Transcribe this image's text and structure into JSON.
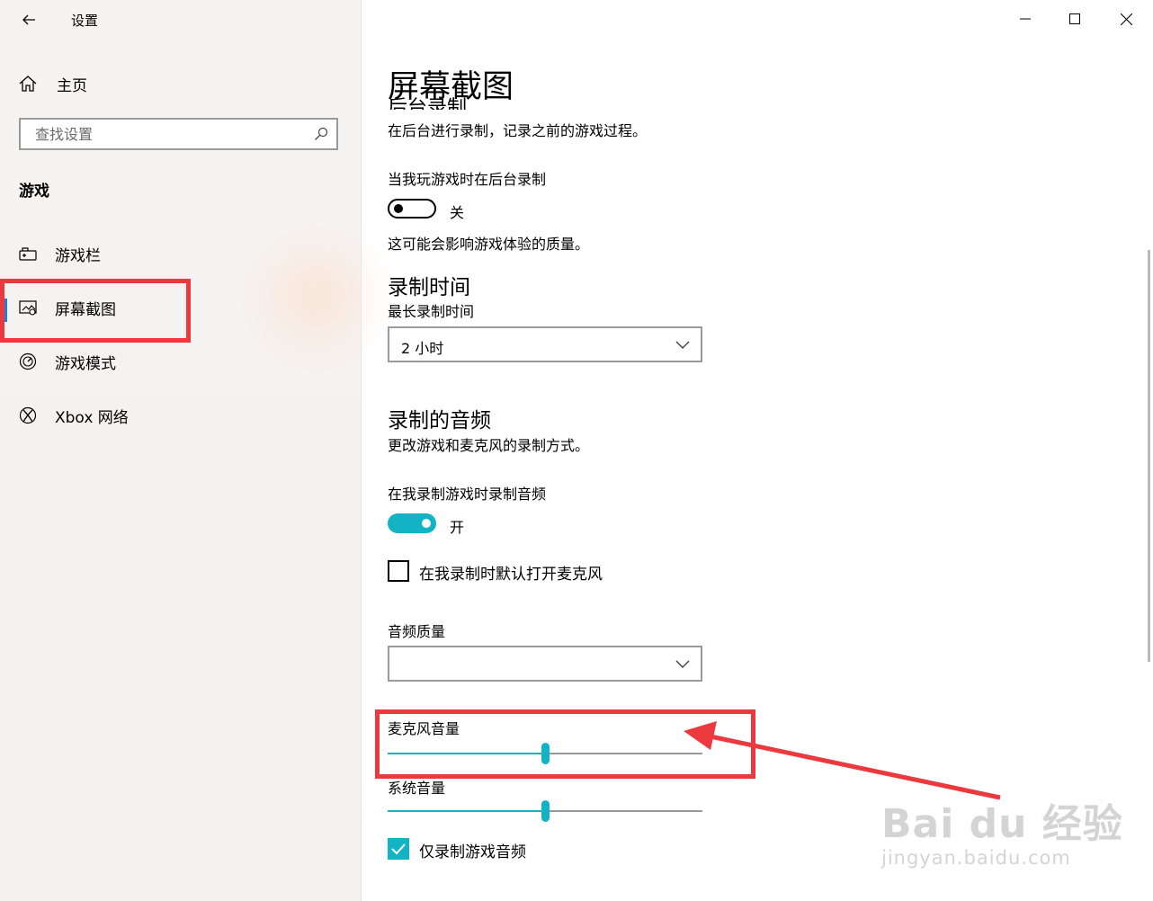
{
  "window": {
    "title": "设置",
    "controls": [
      "minimize-icon",
      "maximize-icon",
      "close-icon"
    ]
  },
  "sidebar": {
    "home_label": "主页",
    "search_placeholder": "查找设置",
    "section_label": "游戏",
    "items": [
      {
        "label": "游戏栏",
        "icon": "game-bar-icon",
        "active": false
      },
      {
        "label": "屏幕截图",
        "icon": "captures-icon",
        "active": true
      },
      {
        "label": "游戏模式",
        "icon": "game-mode-icon",
        "active": false
      },
      {
        "label": "Xbox 网络",
        "icon": "xbox-icon",
        "active": false
      }
    ]
  },
  "main": {
    "page_title": "屏幕截图",
    "background_recording": {
      "heading_partial": "后台录制",
      "description": "在后台进行录制，记录之前的游戏过程。",
      "toggle_title": "当我玩游戏时在后台录制",
      "toggle_state": "关",
      "note": "这可能会影响游戏体验的质量。"
    },
    "recording_time": {
      "heading": "录制时间",
      "label": "最长录制时间",
      "value": "2 小时"
    },
    "recorded_audio": {
      "heading": "录制的音频",
      "description": "更改游戏和麦克风的录制方式。",
      "toggle_title": "在我录制游戏时录制音频",
      "toggle_state": "开",
      "mic_checkbox_label": "在我录制时默认打开麦克风",
      "mic_checkbox_checked": false,
      "quality_label": "音频质量",
      "quality_value": "",
      "mic_volume_label": "麦克风音量",
      "mic_volume_fraction": 0.5,
      "system_volume_label": "系统音量",
      "system_volume_fraction": 0.5,
      "game_only_label": "仅录制游戏音频",
      "game_only_checked": true
    }
  },
  "annotation": {
    "highlight_color": "#ea3a3e"
  },
  "watermark": {
    "main": "Bai du 经验",
    "sub": "jingyan.baidu.com"
  },
  "colors": {
    "accent": "#12b3c4",
    "nav_indicator": "#1e7fd6"
  }
}
